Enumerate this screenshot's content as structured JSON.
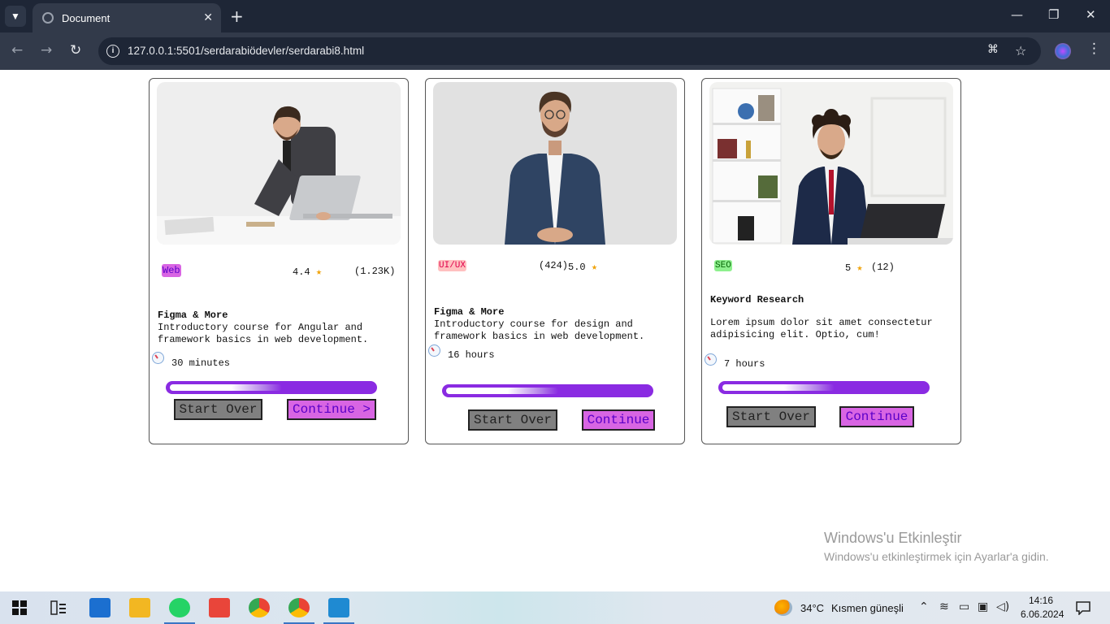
{
  "browser": {
    "tab_title": "Document",
    "url": "127.0.0.1:5501/serdarabiödevler/serdarabi8.html"
  },
  "cards": [
    {
      "tag": "Web",
      "tag_bg": "#d865e3",
      "tag_color": "#5a00c8",
      "rating": "4.4",
      "reviews": "(1.23K)",
      "title": "Figma & More",
      "description": "Introductory course for Angular and framework basics in web development.",
      "duration": "30 minutes",
      "progress": 0.55,
      "start_label": "Start Over",
      "continue_label": "Continue >",
      "photo": "man-in-suit-typing-on-laptop-at-desk"
    },
    {
      "tag": "UI/UX",
      "tag_bg": "#ffc0c0",
      "tag_color": "#e0004c",
      "reviews": "(424)",
      "rating": "5.0",
      "title": "Figma & More",
      "description": "Introductory course for design and framework basics in web development.",
      "duration": "16 hours",
      "progress": 0.55,
      "start_label": "Start Over",
      "continue_label": "Continue",
      "photo": "man-in-denim-shirt-standing"
    },
    {
      "tag": "SEO",
      "tag_bg": "#8ef08e",
      "tag_color": "#0a6a0a",
      "rating": "5",
      "reviews": "(12)",
      "title": "Keyword Research",
      "description": "Lorem ipsum dolor sit amet consectetur adipisicing elit. Optio, cum!",
      "duration": "7 hours",
      "progress": 0.55,
      "start_label": "Start Over",
      "continue_label": "Continue",
      "photo": "man-with-headset-at-office-desk"
    }
  ],
  "watermark": {
    "line1": "Windows'u Etkinleştir",
    "line2": "Windows'u etkinleştirmek için Ayarlar'a gidin."
  },
  "taskbar": {
    "temperature": "34°C",
    "weather": "Kısmen güneşli",
    "time": "14:16",
    "date": "6.06.2024"
  },
  "colors": {
    "progress": "#8a2be2",
    "continue_bg": "#d865e3",
    "start_bg": "#808080",
    "star": "#f0a30a"
  }
}
